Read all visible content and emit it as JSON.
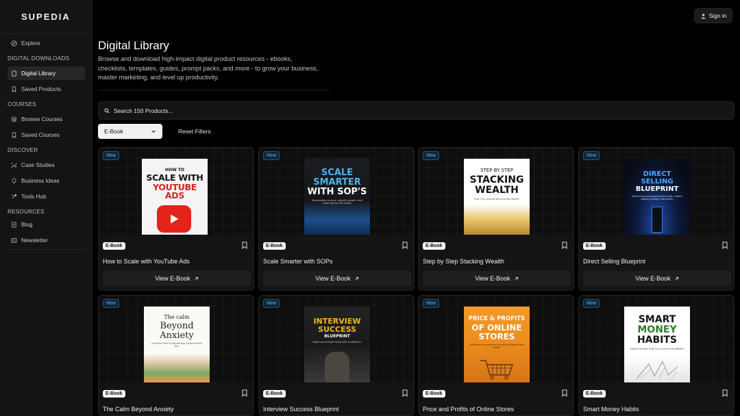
{
  "brand": "SUPEDIA",
  "sidebar": {
    "explore": "Explore",
    "sections": [
      {
        "title": "DIGITAL DOWNLOADS",
        "items": [
          "Digital Library",
          "Saved Products"
        ]
      },
      {
        "title": "COURSES",
        "items": [
          "Browse Courses",
          "Saved Courses"
        ]
      },
      {
        "title": "DISCOVER",
        "items": [
          "Case Studies",
          "Business Ideas",
          "Tools Hub"
        ]
      },
      {
        "title": "RESOURCES",
        "items": [
          "Blog",
          "Newsletter"
        ]
      }
    ]
  },
  "header": {
    "signin_label": "Sign in"
  },
  "page": {
    "title": "Digital Library",
    "description": "Browse and download high-impact digital product resources - ebooks, checklists, templates, guides, prompt packs, and more - to grow your business, master marketing, and level up productivity."
  },
  "search": {
    "placeholder": "Search 150 Products..."
  },
  "filters": {
    "type_selected": "E-Book",
    "reset_label": "Reset Filters"
  },
  "products": [
    {
      "title": "How to Scale with YouTube Ads",
      "badge": "New",
      "type": "E-Book",
      "cta": "View E-Book",
      "cover": {
        "lines": [
          "HOW TO",
          "SCALE WITH",
          "YOUTUBE ADS"
        ]
      }
    },
    {
      "title": "Scale Smarter with SOPs",
      "badge": "New",
      "type": "E-Book",
      "cta": "View E-Book",
      "cover": {
        "lines": [
          "SCALE",
          "SMARTER",
          "WITH SOP'S"
        ],
        "sub": "Standardize success, simplify growth, and scale without the stress"
      }
    },
    {
      "title": "Step by Step Stacking Wealth",
      "badge": "New",
      "type": "E-Book",
      "cta": "View E-Book",
      "cover": {
        "lines": [
          "STEP BY STEP",
          "STACKING",
          "WEALTH"
        ],
        "sub": "How Tiny Savings Become Big Wealth"
      }
    },
    {
      "title": "Direct Selling Blueprint",
      "badge": "New",
      "type": "E-Book",
      "cta": "View E-Book",
      "cover": {
        "lines": [
          "DIRECT",
          "SELLING",
          "BLUEPRINT"
        ],
        "sub": "Build trust and boost income with a direct selling strategy that works."
      }
    },
    {
      "title": "The Calm Beyond Anxiety",
      "badge": "New",
      "type": "E-Book",
      "cta": "View E-Book",
      "cover": {
        "lines": [
          "The calm",
          "Beyond",
          "Anxiety"
        ],
        "sub": "A Gentle Path to Reclaiming Control Every Day"
      }
    },
    {
      "title": "Interview Success Blueprint",
      "badge": "New",
      "type": "E-Book",
      "cta": "View E-Book",
      "cover": {
        "lines": [
          "INTERVIEW",
          "SUCCESS",
          "BLUEPRINT"
        ],
        "sub": "Stand out and get hired with confidence."
      }
    },
    {
      "title": "Price and Profits of Online Stores",
      "badge": "New",
      "type": "E-Book",
      "cta": "View E-Book",
      "cover": {
        "lines": [
          "PRICE & PROFITS",
          "OF ONLINE",
          "STORES"
        ],
        "sub": "Profitable e-commerce and the numbers that matter."
      }
    },
    {
      "title": "Smart Money Habits",
      "badge": "New",
      "type": "E-Book",
      "cta": "View E-Book",
      "cover": {
        "lines": [
          "SMART",
          "MONEY",
          "HABITS"
        ],
        "sub": "Money Smarts That Turn Income Into Wealth"
      }
    }
  ]
}
